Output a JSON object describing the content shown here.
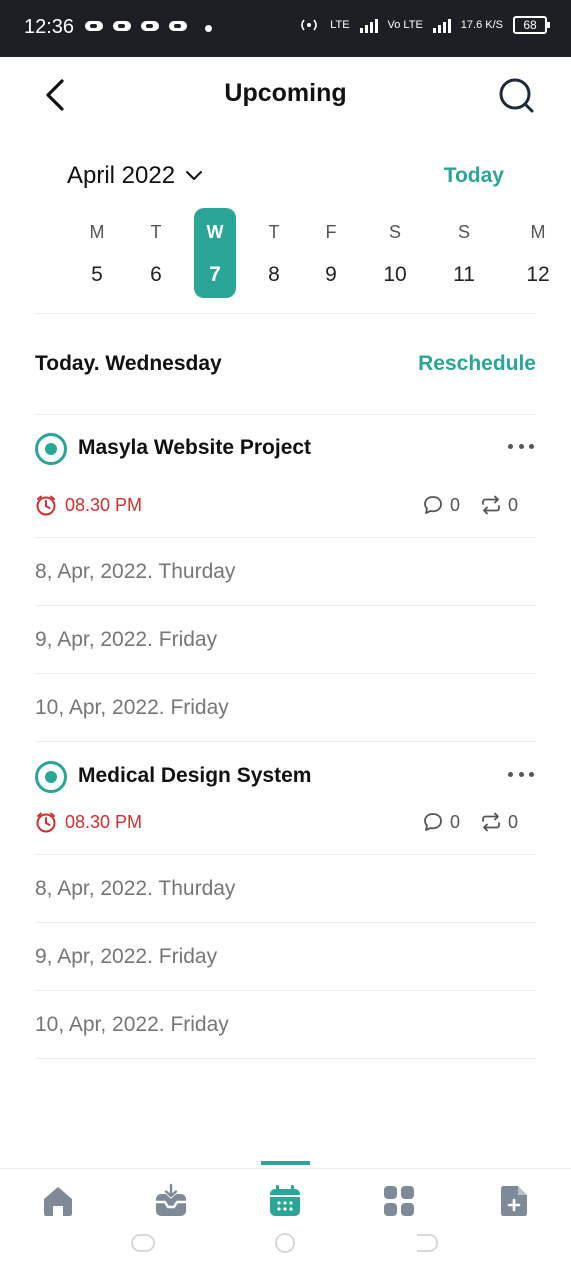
{
  "status_bar": {
    "time": "12:36",
    "net_labels": [
      "LTE",
      "Vo LTE"
    ],
    "speed": "17.6 K/S",
    "battery": "68"
  },
  "header": {
    "title": "Upcoming",
    "back_icon": "chevron-left-icon",
    "search_icon": "search-icon"
  },
  "calendar": {
    "month": "April 2022",
    "today_label": "Today",
    "days": [
      {
        "name": "M",
        "date": "5"
      },
      {
        "name": "T",
        "date": "6"
      },
      {
        "name": "W",
        "date": "7",
        "selected": true
      },
      {
        "name": "T",
        "date": "8"
      },
      {
        "name": "F",
        "date": "9"
      },
      {
        "name": "S",
        "date": "10"
      },
      {
        "name": "S",
        "date": "11"
      },
      {
        "name": "M",
        "date": "12"
      }
    ]
  },
  "section": {
    "title": "Today. Wednesday",
    "reschedule_label": "Reschedule"
  },
  "tasks": [
    {
      "title": "Masyla Website Project",
      "time": "08.30 PM",
      "comments": "0",
      "repeats": "0",
      "dates": [
        "8, Apr, 2022. Thurday",
        "9, Apr, 2022. Friday",
        "10, Apr, 2022. Friday"
      ]
    },
    {
      "title": "Medical Design System",
      "time": "08.30 PM",
      "comments": "0",
      "repeats": "0",
      "dates": [
        "8, Apr, 2022. Thurday",
        "9, Apr, 2022. Friday",
        "10, Apr, 2022. Friday"
      ]
    }
  ],
  "bottom_nav": {
    "items": [
      "home-icon",
      "inbox-icon",
      "calendar-icon",
      "apps-grid-icon",
      "new-document-icon"
    ],
    "active": "calendar-icon"
  },
  "colors": {
    "accent": "#2aa597",
    "overdue": "#d32f2f",
    "muted_text": "#767676",
    "icon_gray": "#7f8a99"
  }
}
